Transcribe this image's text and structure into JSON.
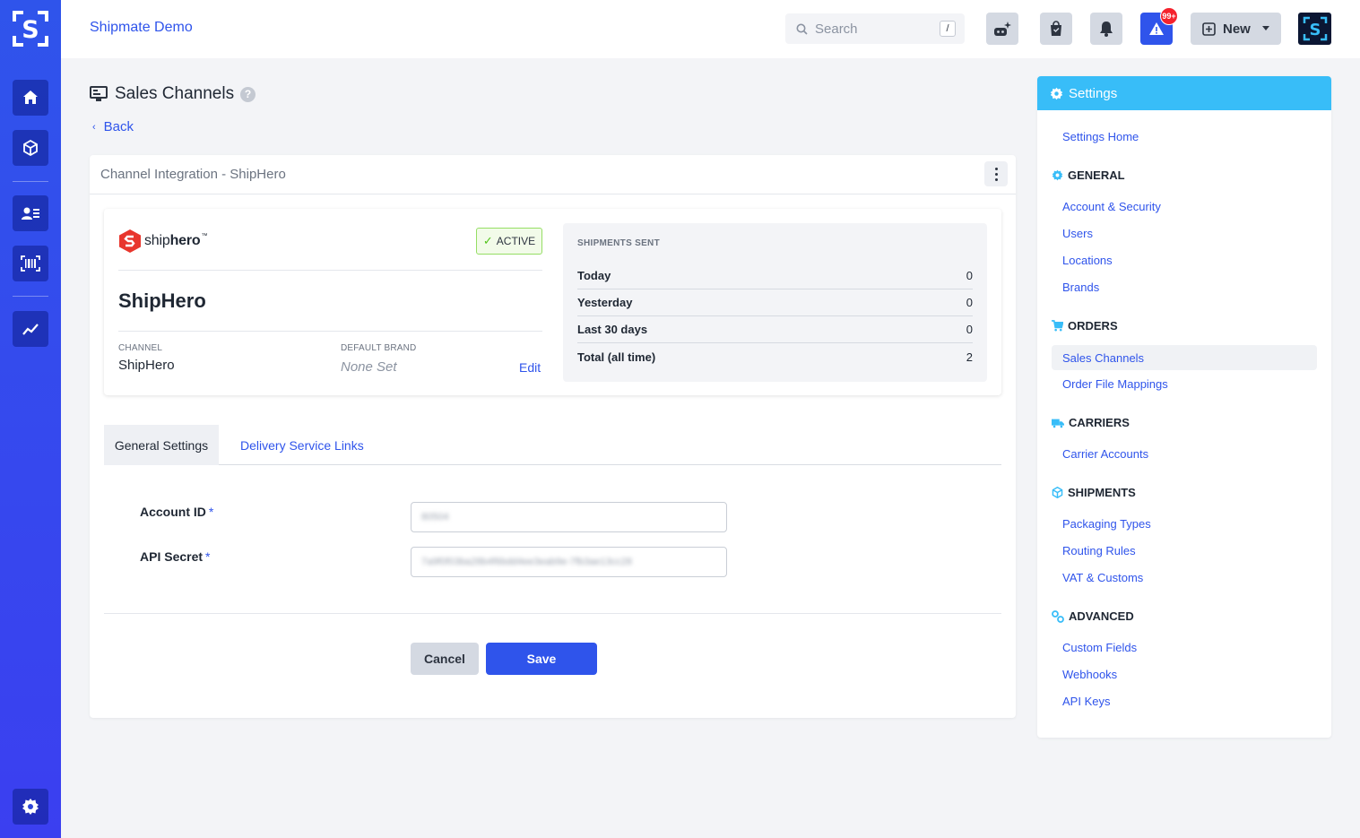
{
  "app": {
    "workspace_name": "Shipmate Demo",
    "search_placeholder": "Search",
    "search_shortcut": "/",
    "notification_badge": "99+",
    "new_button_label": "New",
    "accent_color": "#2f54eb"
  },
  "sidebar": {
    "items": [
      {
        "icon": "home-icon"
      },
      {
        "icon": "box-icon"
      },
      {
        "icon": "contacts-icon"
      },
      {
        "icon": "barcode-scan-icon"
      },
      {
        "icon": "trend-chart-icon"
      },
      {
        "icon": "gear-icon"
      }
    ]
  },
  "page": {
    "title": "Sales Channels",
    "help_icon": "?",
    "back_label": "Back"
  },
  "card": {
    "title": "Channel Integration - ShipHero"
  },
  "integration": {
    "logo_word_light": "ship",
    "logo_word_bold": "hero",
    "logo_tm": "™",
    "status": "ACTIVE",
    "name": "ShipHero",
    "channel_label": "CHANNEL",
    "channel_value": "ShipHero",
    "default_brand_label": "DEFAULT BRAND",
    "default_brand_value": "None Set",
    "edit_label": "Edit"
  },
  "shipments": {
    "header": "SHIPMENTS SENT",
    "rows": [
      {
        "label": "Today",
        "value": "0"
      },
      {
        "label": "Yesterday",
        "value": "0"
      },
      {
        "label": "Last 30 days",
        "value": "0"
      },
      {
        "label": "Total (all time)",
        "value": "2"
      }
    ]
  },
  "tabs": [
    {
      "label": "General Settings",
      "active": true
    },
    {
      "label": "Delivery Service Links",
      "active": false
    }
  ],
  "form": {
    "account_id_label": "Account ID",
    "account_id_value": "80504",
    "api_secret_label": "API Secret",
    "api_secret_value": "7a9f0f03ba28b4f6bdd4ee3eab9e-7fb3ae13cc28",
    "required_mark": "*",
    "cancel_label": "Cancel",
    "save_label": "Save"
  },
  "settings": {
    "title": "Settings",
    "home": "Settings Home",
    "sections": [
      {
        "title": "GENERAL",
        "icon": "gear-icon",
        "items": [
          "Account & Security",
          "Users",
          "Locations",
          "Brands"
        ]
      },
      {
        "title": "ORDERS",
        "icon": "cart-icon",
        "items": [
          "Sales Channels",
          "Order File Mappings"
        ]
      },
      {
        "title": "CARRIERS",
        "icon": "truck-icon",
        "items": [
          "Carrier Accounts"
        ]
      },
      {
        "title": "SHIPMENTS",
        "icon": "box-icon",
        "items": [
          "Packaging Types",
          "Routing Rules",
          "VAT & Customs"
        ]
      },
      {
        "title": "ADVANCED",
        "icon": "gears-icon",
        "items": [
          "Custom Fields",
          "Webhooks",
          "API Keys"
        ]
      }
    ],
    "active_item": "Sales Channels"
  }
}
